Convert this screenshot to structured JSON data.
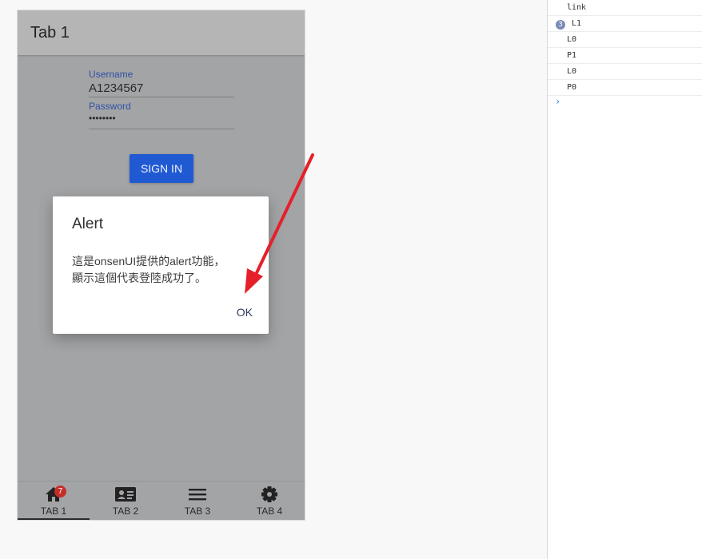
{
  "app": {
    "toolbar_title": "Tab 1"
  },
  "login": {
    "username_label": "Username",
    "username_value": "A1234567",
    "password_label": "Password",
    "password_value": "••••••••",
    "signin_label": "SIGN IN"
  },
  "tabs": [
    {
      "label": "TAB 1",
      "icon": "home-icon",
      "badge": "7",
      "active": true
    },
    {
      "label": "TAB 2",
      "icon": "id-card-icon"
    },
    {
      "label": "TAB 3",
      "icon": "menu-icon"
    },
    {
      "label": "TAB 4",
      "icon": "gear-icon"
    }
  ],
  "alert": {
    "title": "Alert",
    "message_line1": "這是onsenUI提供的alert功能，",
    "message_line2": "顯示這個代表登陸成功了。",
    "ok_label": "OK"
  },
  "console": {
    "lines": [
      {
        "text": "link"
      },
      {
        "text": "L1",
        "repeat": "3"
      },
      {
        "text": "L0"
      },
      {
        "text": "P1"
      },
      {
        "text": "L0"
      },
      {
        "text": "P0"
      }
    ],
    "prompt": "›"
  },
  "colors": {
    "primary_button": "#1f5ad3",
    "badge": "#c42f2a",
    "annotation_arrow": "#e5202a"
  }
}
